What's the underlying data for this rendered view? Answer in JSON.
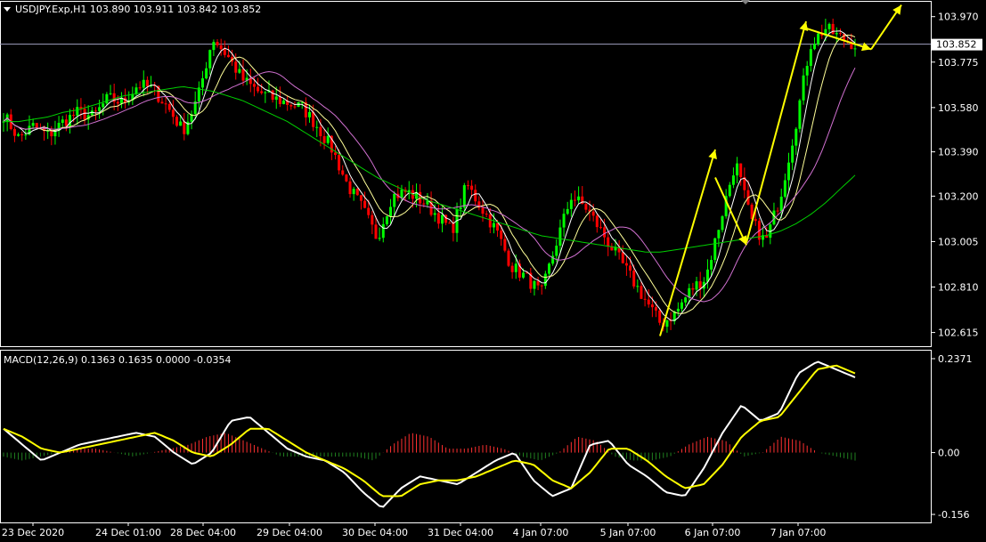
{
  "header": {
    "symbol_line": "USDJPY.Exp,H1  103.890 103.911 103.842 103.852"
  },
  "indicator": {
    "label": "MACD(12,26,9) 0.1363 0.1635 0.0000 -0.0354"
  },
  "colors": {
    "background": "#000000",
    "bull": "#00ff00",
    "bear": "#ff0000",
    "grid": "#ffffff",
    "bid_line": "#a0a0c0",
    "ma_fast": "#ffffff",
    "ma_mid": "#ffff99",
    "ma_slow": "#d070d0",
    "ma_long": "#00d000",
    "arrow": "#ffff00",
    "macd_line": "#ffffff",
    "signal_line": "#ffff00",
    "hist_pos": "#ff3030",
    "hist_neg": "#208020"
  },
  "chart_data": [
    {
      "type": "candlestick",
      "title": "USDJPY.Exp,H1",
      "ohlc_last": {
        "open": 103.89,
        "high": 103.911,
        "low": 103.842,
        "close": 103.852
      },
      "current_price": "103.852",
      "y_ticks": [
        "103.970",
        "103.775",
        "103.580",
        "103.390",
        "103.200",
        "103.005",
        "102.810",
        "102.615"
      ],
      "ylim": [
        102.56,
        104.03
      ],
      "x_ticks": [
        "23 Dec 2020",
        "24 Dec 01:00",
        "28 Dec 04:00",
        "29 Dec 04:00",
        "30 Dec 04:00",
        "31 Dec 04:00",
        "4 Jan 07:00",
        "5 Jan 07:00",
        "6 Jan 07:00",
        "7 Jan 07:00"
      ],
      "close_path": [
        103.55,
        103.45,
        103.5,
        103.46,
        103.52,
        103.56,
        103.54,
        103.62,
        103.6,
        103.68,
        103.66,
        103.58,
        103.48,
        103.62,
        103.88,
        103.8,
        103.7,
        103.65,
        103.62,
        103.6,
        103.58,
        103.5,
        103.4,
        103.25,
        103.15,
        103.02,
        103.2,
        103.22,
        103.18,
        103.12,
        103.05,
        103.25,
        103.15,
        103.05,
        102.9,
        102.85,
        102.78,
        103.0,
        103.2,
        103.15,
        103.05,
        102.95,
        102.85,
        102.75,
        102.65,
        102.7,
        102.8,
        102.85,
        103.1,
        103.35,
        103.1,
        103.0,
        103.2,
        103.5,
        103.85,
        103.92,
        103.88,
        103.85
      ],
      "ma_long_path": [
        103.52,
        103.52,
        103.53,
        103.54,
        103.56,
        103.57,
        103.59,
        103.61,
        103.63,
        103.64,
        103.65,
        103.66,
        103.67,
        103.66,
        103.65,
        103.63,
        103.61,
        103.58,
        103.55,
        103.52,
        103.48,
        103.44,
        103.4,
        103.36,
        103.32,
        103.28,
        103.25,
        103.22,
        103.19,
        103.17,
        103.15,
        103.13,
        103.11,
        103.09,
        103.07,
        103.05,
        103.03,
        103.02,
        103.01,
        103.0,
        102.99,
        102.98,
        102.97,
        102.96,
        102.96,
        102.97,
        102.98,
        102.99,
        103.0,
        103.01,
        103.02,
        103.03,
        103.05,
        103.08,
        103.12,
        103.17,
        103.23,
        103.29
      ],
      "arrows": [
        {
          "from": [
            0,
            102.6
          ],
          "to": [
            1,
            103.4
          ]
        },
        {
          "from": [
            1,
            103.28
          ],
          "to": [
            2,
            102.99
          ]
        },
        {
          "from": [
            2,
            103.0
          ],
          "to": [
            3,
            103.95
          ]
        },
        {
          "from": [
            3,
            103.92
          ],
          "to": [
            4,
            103.83
          ]
        },
        {
          "from": [
            4,
            103.83
          ],
          "to": [
            5,
            104.02
          ]
        }
      ],
      "macd": {
        "ylim": [
          -0.156,
          0.2371
        ],
        "y_ticks": [
          "0.2371",
          "0.00",
          "-0.156"
        ],
        "main_path": [
          0.06,
          0.02,
          -0.02,
          0.0,
          0.02,
          0.03,
          0.04,
          0.05,
          0.04,
          0.0,
          -0.03,
          0.0,
          0.08,
          0.09,
          0.05,
          0.01,
          -0.01,
          -0.02,
          -0.05,
          -0.1,
          -0.14,
          -0.09,
          -0.06,
          -0.07,
          -0.08,
          -0.05,
          -0.02,
          0.0,
          -0.07,
          -0.11,
          -0.09,
          0.02,
          0.03,
          -0.03,
          -0.06,
          -0.1,
          -0.11,
          -0.04,
          0.05,
          0.12,
          0.08,
          0.1,
          0.2,
          0.23,
          0.21,
          0.19
        ],
        "signal_path": [
          0.06,
          0.04,
          0.01,
          0.0,
          0.01,
          0.02,
          0.03,
          0.04,
          0.05,
          0.03,
          0.0,
          -0.01,
          0.02,
          0.06,
          0.06,
          0.03,
          0.0,
          -0.02,
          -0.04,
          -0.07,
          -0.11,
          -0.11,
          -0.08,
          -0.07,
          -0.07,
          -0.06,
          -0.04,
          -0.02,
          -0.03,
          -0.07,
          -0.09,
          -0.05,
          0.01,
          0.01,
          -0.02,
          -0.06,
          -0.09,
          -0.08,
          -0.03,
          0.04,
          0.08,
          0.09,
          0.15,
          0.21,
          0.22,
          0.2
        ],
        "hist_path": [
          -0.01,
          -0.02,
          -0.01,
          0.0,
          0.01,
          0.01,
          0.0,
          -0.01,
          0.0,
          0.01,
          0.02,
          0.04,
          0.05,
          0.03,
          0.01,
          -0.01,
          -0.01,
          -0.01,
          -0.01,
          -0.01,
          -0.02,
          0.02,
          0.05,
          0.04,
          0.01,
          0.01,
          0.02,
          0.01,
          -0.01,
          -0.02,
          0.0,
          0.04,
          0.03,
          -0.01,
          -0.02,
          -0.02,
          -0.01,
          0.02,
          0.04,
          0.03,
          -0.01,
          0.0,
          0.04,
          0.03,
          0.0,
          -0.01,
          -0.02
        ]
      }
    }
  ]
}
